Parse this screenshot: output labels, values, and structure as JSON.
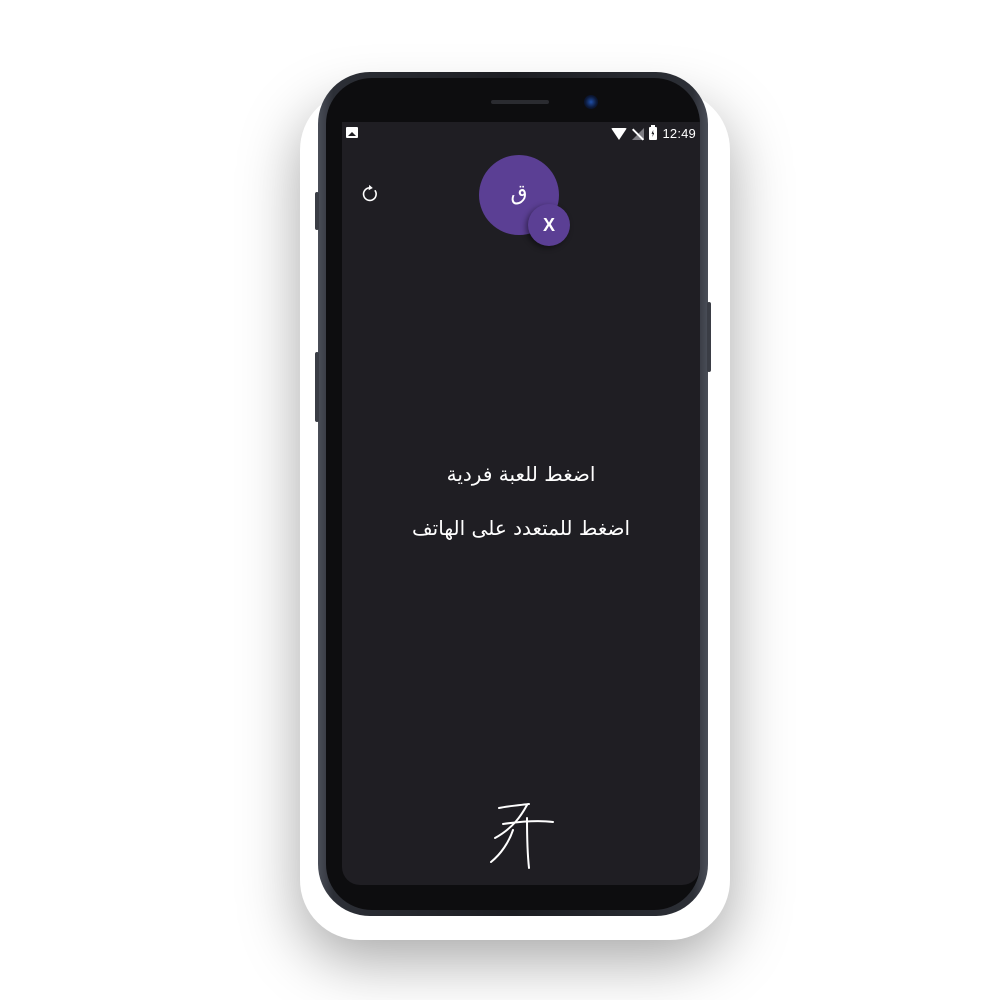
{
  "status_bar": {
    "time": "12:49",
    "icons": [
      "image-notification-icon",
      "wifi-icon",
      "no-signal-icon",
      "battery-charging-icon"
    ]
  },
  "toolbar": {
    "reset_icon": "refresh-icon"
  },
  "avatar": {
    "main_letter": "ق",
    "badge_letter": "X",
    "color": "#5b3f94"
  },
  "menu": {
    "single_player_label": "اضغط للعبة فردية",
    "multiplayer_label": "اضغط للمتعدد على الهاتف"
  },
  "branding": {
    "logo_icon": "calligraphy-logo-icon"
  },
  "colors": {
    "screen_background": "#1f1e23",
    "accent": "#5b3f94",
    "text": "#ffffff"
  }
}
